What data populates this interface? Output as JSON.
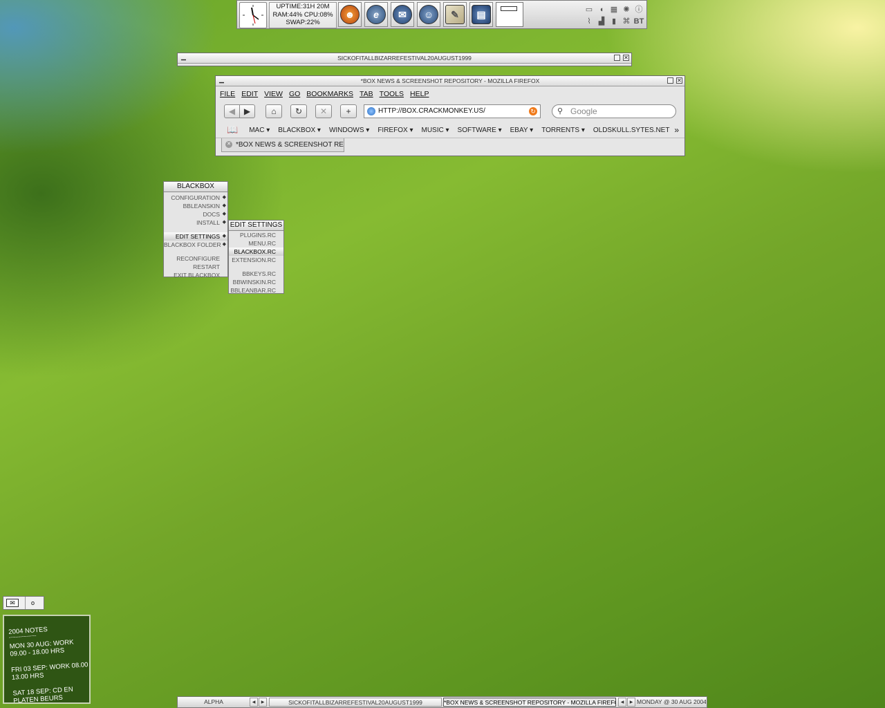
{
  "sysinfo": {
    "uptime": "UPTIME:31H 20M",
    "ram_cpu": "RAM:44% CPU:08%",
    "swap": "SWAP:22%"
  },
  "dock_icons": [
    "firefox-icon",
    "ie-icon",
    "mail-icon",
    "gaim-icon",
    "notepad-icon",
    "trash-icon"
  ],
  "tray": {
    "bt_label": "BT"
  },
  "window_bg": {
    "title": "SICKOFITALLBIZARREFESTIVAL20AUGUST1999"
  },
  "firefox": {
    "title": "*BOX NEWS & SCREENSHOT REPOSITORY - MOZILLA FIREFOX",
    "menus": [
      "FILE",
      "EDIT",
      "VIEW",
      "GO",
      "BOOKMARKS",
      "TAB",
      "TOOLS",
      "HELP"
    ],
    "url": "HTTP://BOX.CRACKMONKEY.US/",
    "search_placeholder": "Google",
    "bookmarks": [
      "MAC",
      "BLACKBOX",
      "WINDOWS",
      "FIREFOX",
      "MUSIC",
      "SOFTWARE",
      "EBAY",
      "TORRENTS",
      "OLDSKULL.SYTES.NET"
    ],
    "tab_label": "*BOX NEWS & SCREENSHOT RE..."
  },
  "root_menu": {
    "title": "BLACKBOX",
    "items": [
      "CONFIGURATION",
      "BBLEANSKIN",
      "DOCS",
      "INSTALL",
      "EDIT SETTINGS",
      "BLACKBOX FOLDER",
      "RECONFIGURE",
      "RESTART",
      "EXIT BLACKBOX"
    ]
  },
  "sub_menu": {
    "title": "EDIT SETTINGS",
    "items": [
      "PLUGINS.RC",
      "MENU.RC",
      "BLACKBOX.RC",
      "EXTENSION.RC",
      "BBKEYS.RC",
      "BBWINSKIN.RC",
      "BBLEANBAR.RC"
    ]
  },
  "notes": {
    "title": "2004 NOTES",
    "divider": "-----------------",
    "entries": [
      "MON 30 AUG: WORK 09.00 - 18.00 HRS",
      "FRI 03 SEP: WORK 08.00 - 13.00 HRS",
      "SAT 18 SEP: CD EN PLATEN BEURS"
    ]
  },
  "taskbar": {
    "workspace": "ALPHA",
    "task1": "SICKOFITALLBIZARREFESTIVAL20AUGUST1999",
    "task2": "*BOX NEWS & SCREENSHOT REPOSITORY - MOZILLA FIREFOX",
    "clock": "MONDAY @ 30 AUG 2004"
  }
}
